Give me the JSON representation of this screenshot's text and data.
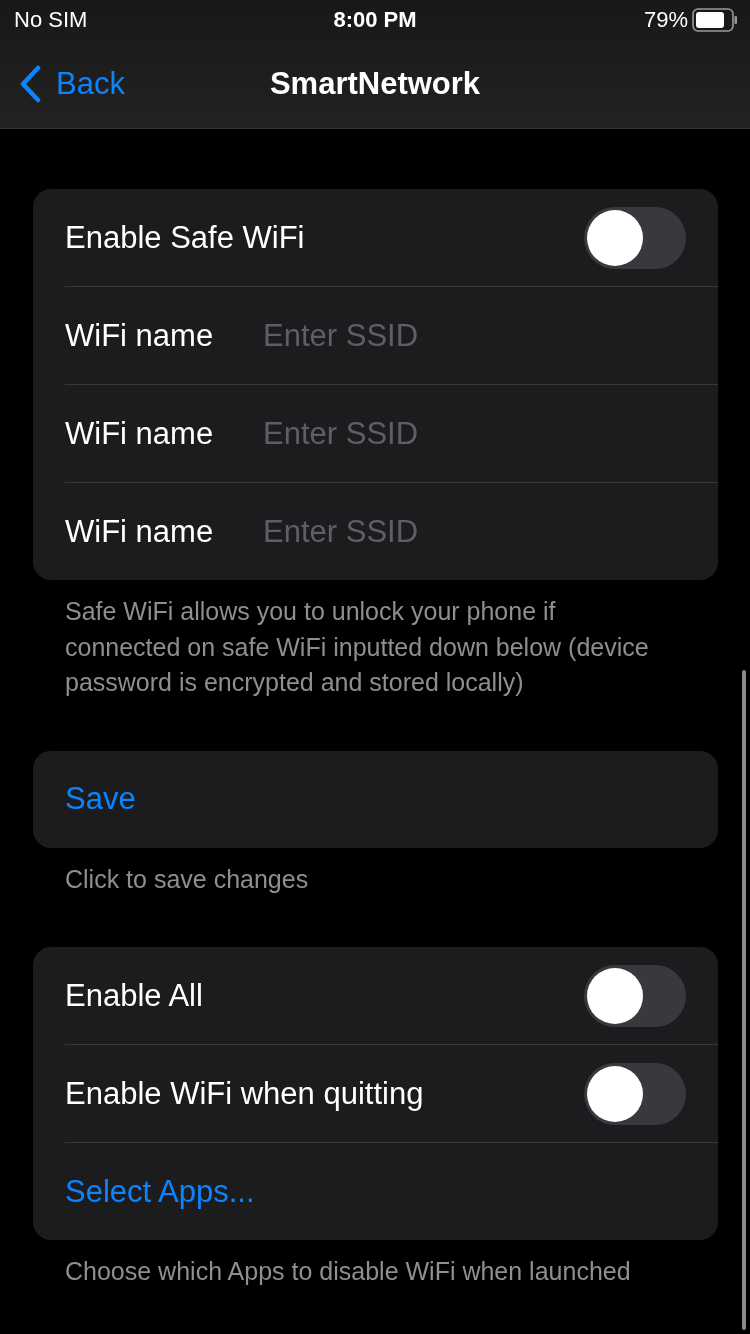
{
  "status_bar": {
    "carrier": "No SIM",
    "time": "8:00 PM",
    "battery": "79%"
  },
  "nav": {
    "back": "Back",
    "title": "SmartNetwork"
  },
  "sections": [
    {
      "rows": [
        {
          "kind": "toggle",
          "label": "Enable Safe WiFi",
          "on": false
        },
        {
          "kind": "field",
          "label": "WiFi name",
          "placeholder": "Enter SSID"
        },
        {
          "kind": "field",
          "label": "WiFi name",
          "placeholder": "Enter SSID"
        },
        {
          "kind": "field",
          "label": "WiFi name",
          "placeholder": "Enter SSID"
        }
      ],
      "footer": "Safe WiFi allows you to unlock your phone if connected on safe WiFi inputted down below (device password is encrypted and stored locally)"
    },
    {
      "rows": [
        {
          "kind": "action",
          "label": "Save"
        }
      ],
      "footer": "Click to save changes"
    },
    {
      "rows": [
        {
          "kind": "toggle",
          "label": "Enable All",
          "on": false
        },
        {
          "kind": "toggle",
          "label": "Enable WiFi when quitting",
          "on": false
        },
        {
          "kind": "action",
          "label": "Select Apps..."
        }
      ],
      "footer": "Choose which Apps to disable WiFi when launched"
    }
  ]
}
